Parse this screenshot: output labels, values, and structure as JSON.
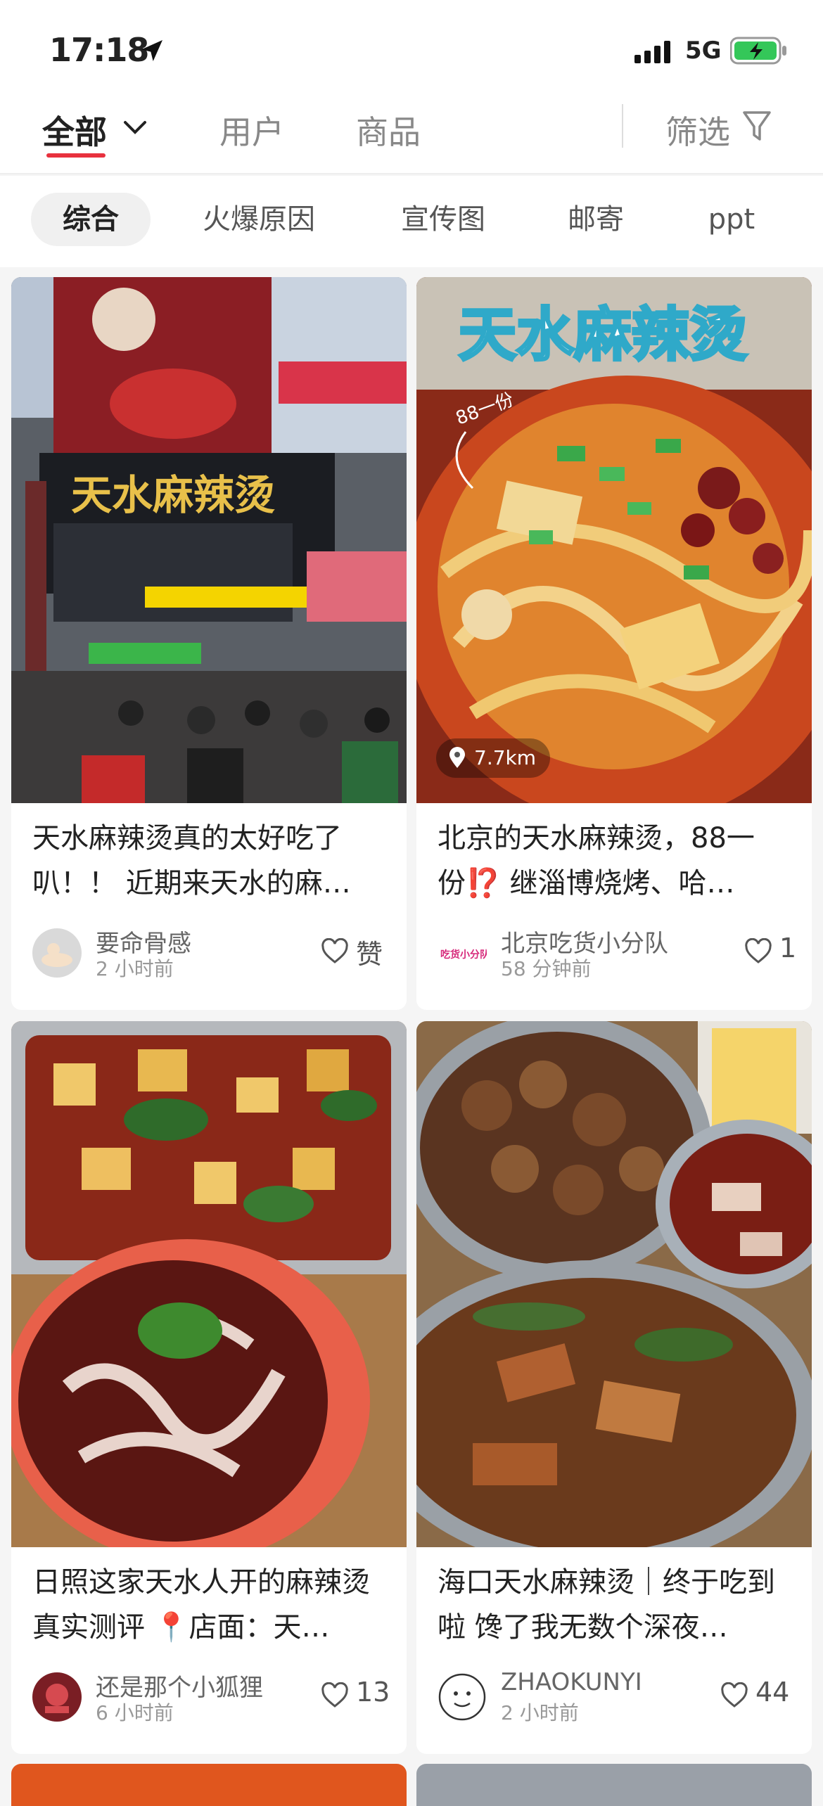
{
  "status_bar": {
    "time": "17:18",
    "network": "5G"
  },
  "tabs": {
    "all": "全部",
    "users": "用户",
    "goods": "商品",
    "filter": "筛选"
  },
  "chips": [
    "综合",
    "火爆原因",
    "宣传图",
    "邮寄",
    "ppt"
  ],
  "cards": [
    {
      "title": "天水麻辣烫真的太好吃了叭！！ 近期来天水的麻…",
      "author": "要命骨感",
      "ago": "2 小时前",
      "likes": "赞",
      "image": "storefront-photo"
    },
    {
      "title": "北京的天水麻辣烫，88一份⁉️ 继淄博烧烤、哈…",
      "author": "北京吃货小分队",
      "ago": "58 分钟前",
      "likes": "1",
      "image": "noodle-dish-photo",
      "distance": "7.7km",
      "image_text": "天水麻辣烫",
      "image_note": "88一份",
      "avatar_text": "吃货小分队"
    },
    {
      "title": "日照这家天水人开的麻辣烫真实测评 📍店面：天…",
      "author": "还是那个小狐狸",
      "ago": "6 小时前",
      "likes": "13",
      "image": "spicy-tofu-noodle-photo"
    },
    {
      "title": "海口天水麻辣烫｜终于吃到啦 馋了我无数个深夜…",
      "author": "ZHAOKUNYI",
      "ago": "2 小时前",
      "likes": "44",
      "image": "bowls-of-food-photo"
    }
  ],
  "storefront_sign": "天水麻辣烫",
  "colors": {
    "accent": "#e8313e",
    "battery": "#34c759"
  }
}
